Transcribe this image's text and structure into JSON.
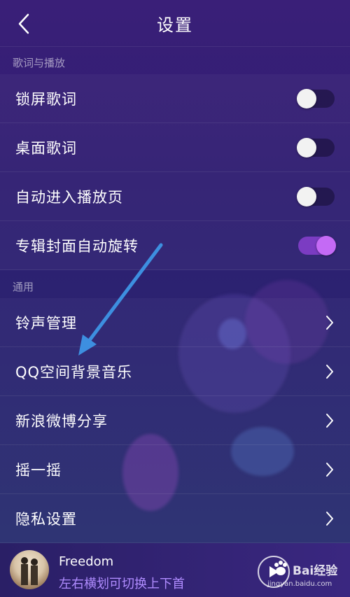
{
  "header": {
    "title": "设置"
  },
  "sections": {
    "lyrics_label": "歌词与播放",
    "general_label": "通用"
  },
  "lyrics_items": [
    {
      "label": "锁屏歌词",
      "on": false
    },
    {
      "label": "桌面歌词",
      "on": false
    },
    {
      "label": "自动进入播放页",
      "on": false
    },
    {
      "label": "专辑封面自动旋转",
      "on": true
    }
  ],
  "general_items": [
    {
      "label": "铃声管理"
    },
    {
      "label": "QQ空间背景音乐"
    },
    {
      "label": "新浪微博分享"
    },
    {
      "label": "摇一摇"
    },
    {
      "label": "隐私设置"
    }
  ],
  "player": {
    "title": "Freedom",
    "subtitle": "左右横划可切换上下首"
  },
  "watermark": {
    "main": "Bai经验",
    "sub": "jingyan.baidu.com"
  },
  "colors": {
    "accent": "#c46af5",
    "arrow": "#3d8fe0"
  }
}
